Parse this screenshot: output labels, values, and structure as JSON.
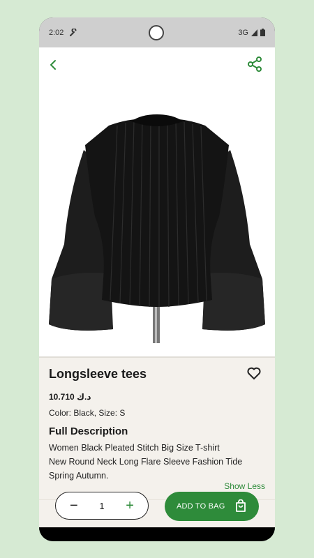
{
  "status": {
    "time": "2:02",
    "network": "3G"
  },
  "product": {
    "title": "Longsleeve tees",
    "price": "10.710 د.ك",
    "variant": "Color: Black, Size: S",
    "description_heading": "Full Description",
    "description_lines": [
      "Women Black Pleated Stitch Big Size T-shirt",
      "New Round Neck Long Flare Sleeve Fashion Tide",
      "Spring Autumn."
    ],
    "show_less": "Show Less"
  },
  "cart": {
    "quantity": "1",
    "minus": "−",
    "plus": "+",
    "add_label": "ADD TO BAG"
  },
  "colors": {
    "accent": "#2e8b3a",
    "background": "#f4f1ec",
    "page": "#d6ead3"
  },
  "icons": [
    "back-arrow-icon",
    "share-icon",
    "heart-icon",
    "shopping-bag-icon",
    "wrench-icon",
    "battery-icon"
  ]
}
